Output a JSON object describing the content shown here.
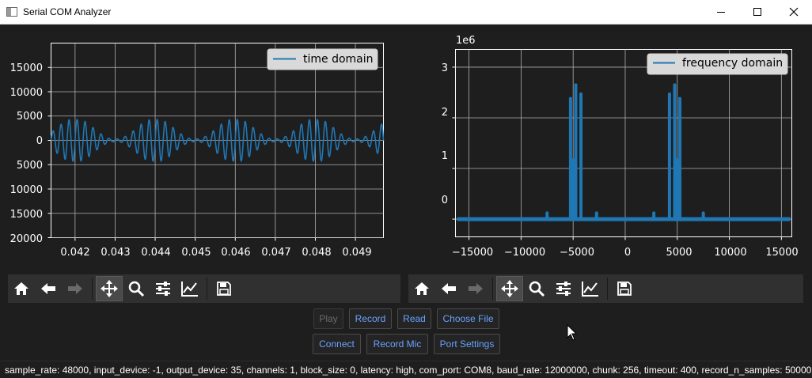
{
  "window": {
    "title": "Serial COM Analyzer"
  },
  "time_plot": {
    "legend": "time domain",
    "y_ticks": [
      "15000",
      "10000",
      "5000",
      "0",
      "5000",
      "10000",
      "15000",
      "20000"
    ],
    "x_ticks": [
      "0.042",
      "0.043",
      "0.044",
      "0.045",
      "0.046",
      "0.047",
      "0.048",
      "0.049"
    ]
  },
  "freq_plot": {
    "legend": "frequency domain",
    "offset_label": "1e6",
    "y_ticks": [
      "3",
      "2",
      "1",
      "0"
    ],
    "x_ticks": [
      "−15000",
      "−10000",
      "−5000",
      "0",
      "5000",
      "10000",
      "15000"
    ]
  },
  "buttons": {
    "play": "Play",
    "record": "Record",
    "read": "Read",
    "choose_file": "Choose File",
    "connect": "Connect",
    "record_mic": "Record Mic",
    "port_settings": "Port Settings"
  },
  "status": "sample_rate: 48000, input_device: -1, output_device: 35, channels: 1, block_size: 0, latency: high, com_port: COM8, baud_rate: 12000000, chunk: 256, timeout: 400, record_n_samples: 50000",
  "colors": {
    "line": "#1f77b4",
    "background": "#1e1e1e",
    "button_text": "#6aa2ff"
  },
  "chart_data": [
    {
      "type": "line",
      "title": "",
      "legend": [
        "time domain"
      ],
      "xlim": [
        0.0414,
        0.0497
      ],
      "ylim": [
        -20000,
        20000
      ],
      "grid": true,
      "legend_position": "top-right",
      "series": [
        {
          "name": "time domain",
          "envelope_peaks": [
            {
              "x": 0.042,
              "amp": 4200
            },
            {
              "x": 0.044,
              "amp": 4200
            },
            {
              "x": 0.046,
              "amp": 4200
            },
            {
              "x": 0.048,
              "amp": 4200
            }
          ],
          "carrier_hz": 5000,
          "beat_period": 0.002
        }
      ]
    },
    {
      "type": "line",
      "title": "",
      "legend": [
        "frequency domain"
      ],
      "xlim": [
        -16300,
        16000
      ],
      "ylim": [
        -0.35,
        3.35
      ],
      "y_scale_label": "1e6",
      "grid": true,
      "legend_position": "top-right",
      "series": [
        {
          "name": "frequency domain",
          "peaks": [
            {
              "x": -7500,
              "y": 0.12
            },
            {
              "x": -5250,
              "y": 2.38
            },
            {
              "x": -4750,
              "y": 2.65
            },
            {
              "x": -4250,
              "y": 2.47
            },
            {
              "x": -2750,
              "y": 0.12
            },
            {
              "x": 2750,
              "y": 0.12
            },
            {
              "x": 4250,
              "y": 2.47
            },
            {
              "x": 4750,
              "y": 2.65
            },
            {
              "x": 5250,
              "y": 2.38
            },
            {
              "x": 7500,
              "y": 0.12
            }
          ]
        }
      ]
    }
  ]
}
